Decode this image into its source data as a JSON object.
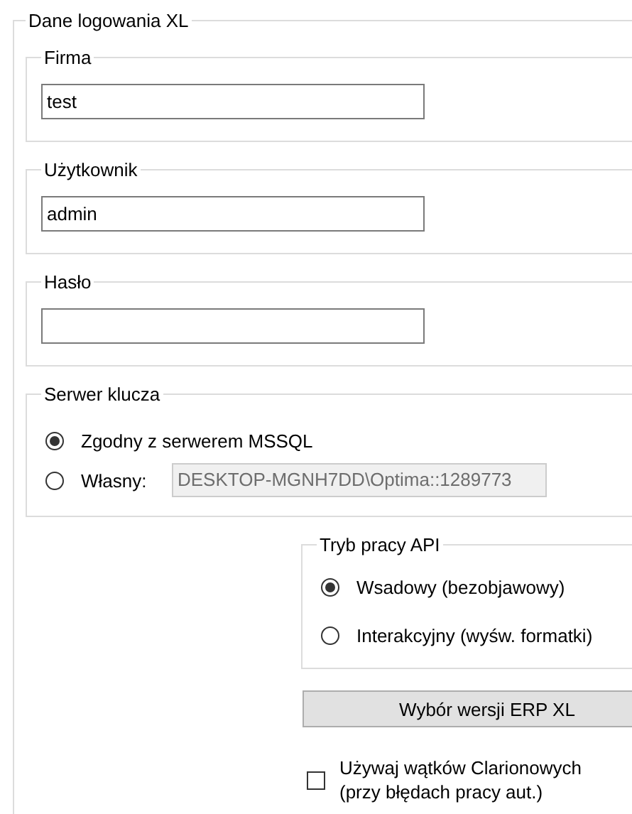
{
  "group": {
    "title": "Dane logowania XL"
  },
  "fields": [
    {
      "label": "Firma",
      "value": "test"
    },
    {
      "label": "Użytkownik",
      "value": "admin"
    },
    {
      "label": "Hasło"
    }
  ],
  "key_server": {
    "title": "Serwer klucza",
    "options": [
      {
        "label": "Zgodny z serwerem MSSQL",
        "selected": true
      },
      {
        "label": "Własny:",
        "selected": false,
        "value": "DESKTOP-MGNH7DD\\Optima::1289773",
        "disabled": true
      }
    ]
  },
  "api_mode": {
    "title": "Tryb pracy API",
    "options": [
      {
        "label": "Wsadowy (bezobjawowy)",
        "selected": true
      },
      {
        "label": "Interakcyjny (wyśw. formatki)",
        "selected": false
      }
    ]
  },
  "button": {
    "label": "Wybór wersji ERP XL"
  },
  "checkbox": {
    "label": "Używaj wątków Clarionowych\n(przy błędach pracy aut.)",
    "checked": false
  }
}
